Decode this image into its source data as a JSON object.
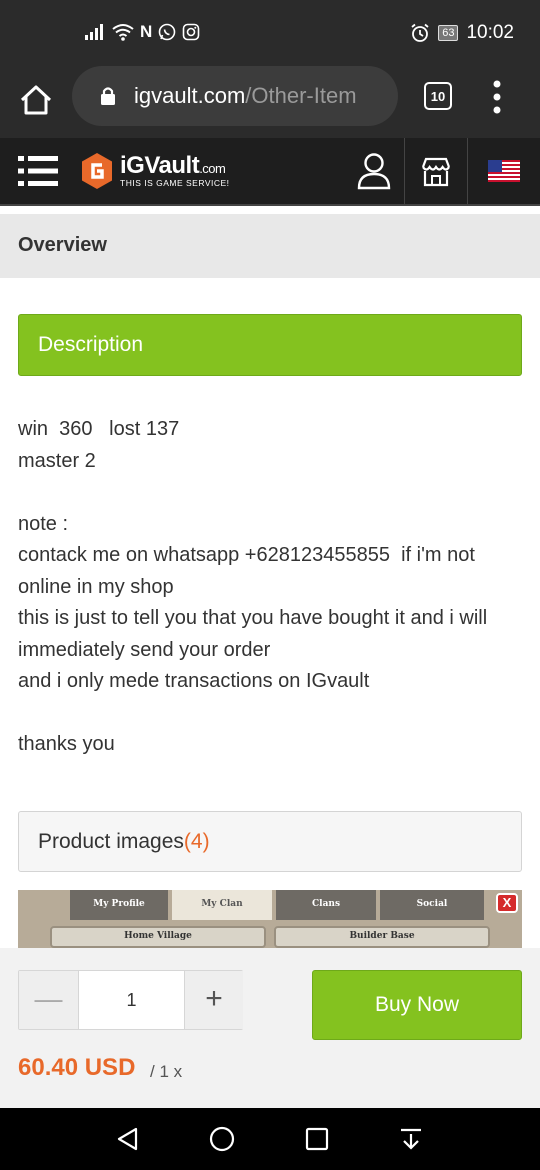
{
  "status_bar": {
    "time": "10:02",
    "battery": "63",
    "carrier_icon": "N"
  },
  "browser": {
    "url_domain": "igvault.com",
    "url_path": "/Other-Item",
    "tab_count": "10"
  },
  "site_header": {
    "logo_name": "iGVault",
    "logo_suffix": ".com",
    "logo_tagline": "THIS IS GAME SERVICE!"
  },
  "overview": {
    "title": "Overview"
  },
  "description": {
    "label": "Description",
    "lines": [
      "win  360   lost 137",
      "master 2",
      "",
      "note :",
      "contack me on whatsapp +628123455855  if i'm not online in my shop",
      "this is just to tell you that you have bought it and i will immediately send your order",
      "and i only mede transactions on IGvault",
      "",
      "thanks you"
    ]
  },
  "product_images": {
    "label": "Product images",
    "count": "(4)"
  },
  "game_screenshot": {
    "tabs": [
      "My Profile",
      "My Clan",
      "Clans",
      "Social"
    ],
    "close": "X",
    "sub_tabs": [
      "Home Village",
      "Builder Base"
    ]
  },
  "purchase": {
    "quantity": "1",
    "minus": "—",
    "plus": "+",
    "buy_label": "Buy Now",
    "price": "60.40 USD",
    "unit": "/ 1 x"
  },
  "colors": {
    "accent_green": "#84c21f",
    "price_orange": "#e8692a",
    "header_dark": "#1e1e1e"
  }
}
